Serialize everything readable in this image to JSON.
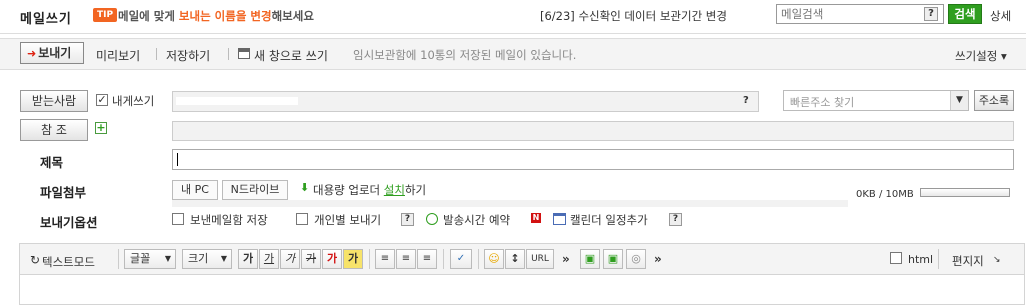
{
  "header": {
    "title": "메일쓰기",
    "tip_badge": "TIP",
    "tip_text_1": "메일에 맞게 ",
    "tip_text_highlight": "보내는 이름을 변경",
    "tip_text_2": "해보세요",
    "notice": "[6/23] 수신확인 데이터 보관기간 변경",
    "search_placeholder": "메일검색",
    "search_help": "?",
    "search_button": "검색",
    "detail_link": "상세"
  },
  "toolbar": {
    "send_label": "보내기",
    "preview_label": "미리보기",
    "save_label": "저장하기",
    "new_window_label": "새 창으로 쓰기",
    "info": "임시보관함에 10통의 저장된 메일이 있습니다.",
    "settings_label": "쓰기설정 ▾"
  },
  "form": {
    "recipient_button": "받는사람",
    "to_self_label": "내게쓰기",
    "to_self_checked": "✓",
    "recipient_help": "?",
    "quick_address_placeholder": "빠른주소 찾기",
    "address_book_button": "주소록",
    "cc_button": "참 조",
    "add_icon": "+",
    "subject_label": "제목",
    "attach_label": "파일첨부",
    "attach_tab_pc": "내 PC",
    "attach_tab_ndrive": "N드라이브",
    "bulk_upload_text_1": "대용량 업로더 ",
    "bulk_upload_link": "설치",
    "bulk_upload_text_2": "하기",
    "quota_text": "0KB / 10MB",
    "quota_used": 0,
    "options_label": "보내기옵션",
    "opt_save_sent": "보낸메일함 저장",
    "opt_individual": "개인별 보내기",
    "opt_help": "?",
    "opt_schedule": "발송시간 예약",
    "opt_new_badge": "N",
    "opt_calendar": "캘린더 일정추가",
    "opt_calendar_help": "?"
  },
  "editor": {
    "text_mode": "텍스트모드",
    "font_select": "글꼴",
    "size_select": "크기",
    "bold": "가",
    "underline": "가",
    "italic": "가",
    "strike": "가",
    "font_color": "가",
    "bg_color": "가",
    "url_button": "URL",
    "more": "»",
    "html_label": "html",
    "stationery": "편지지"
  },
  "colors": {
    "accent_orange": "#f26522",
    "search_green": "#2f9e1f",
    "link_green": "#2f9e1f",
    "red": "#d21111"
  }
}
